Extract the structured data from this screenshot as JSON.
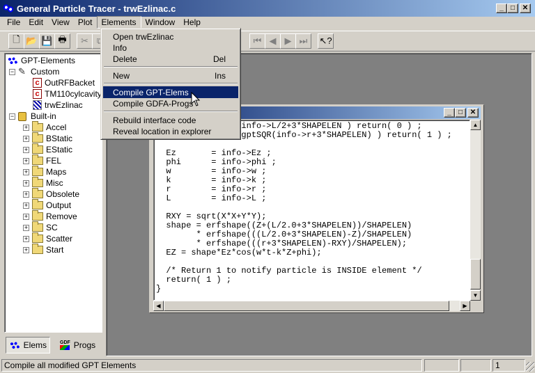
{
  "app": {
    "title": "General Particle Tracer - trwEzlinac.c"
  },
  "menubar": {
    "items": [
      "File",
      "Edit",
      "View",
      "Plot",
      "Elements",
      "Window",
      "Help"
    ]
  },
  "elements_menu": {
    "groups": [
      [
        {
          "label": "Open trwEzlinac",
          "shortcut": ""
        },
        {
          "label": "Info",
          "shortcut": ""
        },
        {
          "label": "Delete",
          "shortcut": "Del"
        }
      ],
      [
        {
          "label": "New",
          "shortcut": "Ins"
        }
      ],
      [
        {
          "label": "Compile GPT-Elems",
          "shortcut": "",
          "highlighted": true
        },
        {
          "label": "Compile GDFA-Progs",
          "shortcut": ""
        }
      ],
      [
        {
          "label": "Rebuild interface code",
          "shortcut": ""
        },
        {
          "label": "Reveal location in explorer",
          "shortcut": ""
        }
      ]
    ]
  },
  "toolbar": {
    "buttons": [
      {
        "icon": "new-file-icon",
        "glyph": "🗋",
        "enabled": true
      },
      {
        "icon": "open-folder-icon",
        "glyph": "📂",
        "enabled": true
      },
      {
        "icon": "save-icon",
        "glyph": "💾",
        "enabled": true
      },
      {
        "icon": "print-icon",
        "glyph": "🖶",
        "enabled": true
      },
      {
        "icon": "cut-icon",
        "glyph": "✂",
        "enabled": false
      },
      {
        "icon": "copy-icon",
        "glyph": "⧉",
        "enabled": false
      },
      {
        "icon": "first-icon",
        "glyph": "⏮",
        "enabled": false
      },
      {
        "icon": "previous-icon",
        "glyph": "◀",
        "enabled": false
      },
      {
        "icon": "next-icon",
        "glyph": "▶",
        "enabled": false
      },
      {
        "icon": "last-icon",
        "glyph": "⏭",
        "enabled": false
      },
      {
        "icon": "context-help-icon",
        "glyph": "↖?",
        "enabled": true
      }
    ]
  },
  "tree": {
    "root": "GPT-Elements",
    "custom": {
      "label": "Custom",
      "children": [
        {
          "label": "OutRFBacket",
          "icon": "c-source-icon"
        },
        {
          "label": "TM110cylcavity",
          "icon": "c-source-icon"
        },
        {
          "label": "trwEzlinac",
          "icon": "gpt-element-icon"
        }
      ]
    },
    "builtin": {
      "label": "Built-in",
      "children": [
        "Accel",
        "BStatic",
        "EStatic",
        "FEL",
        "Maps",
        "Misc",
        "Obsolete",
        "Output",
        "Remove",
        "SC",
        "Scatter",
        "Start"
      ]
    }
  },
  "tabs": [
    {
      "label": "Elems",
      "icon": "elements-icon",
      "active": true
    },
    {
      "label": "Progs",
      "icon": "gdf-programs-icon",
      "badge": "GDF",
      "active": false
    }
  ],
  "editor": {
    "lines": [
      "                 info->L/2+3*SHAPELEN ) return( 0 ) ;",
      "                 gptSQR(info->r+3*SHAPELEN) ) return( 1 ) ;",
      "",
      "  Ez       = info->Ez ;",
      "  phi      = info->phi ;",
      "  w        = info->w ;",
      "  k        = info->k ;",
      "  r        = info->r ;",
      "  L        = info->L ;",
      "",
      "  RXY = sqrt(X*X+Y*Y);",
      "  shape = erfshape((Z+(L/2.0+3*SHAPELEN))/SHAPELEN)",
      "        * erfshape(((L/2.0+3*SHAPELEN)-Z)/SHAPELEN)",
      "        * erfshape(((r+3*SHAPELEN)-RXY)/SHAPELEN);",
      "  EZ = shape*Ez*cos(w*t-k*Z+phi);",
      "",
      "  /* Return 1 to notify particle is INSIDE element */",
      "  return( 1 ) ;",
      "}"
    ]
  },
  "statusbar": {
    "message": "Compile all modified GPT Elements",
    "pane3": "1"
  },
  "colors": {
    "titlebar": "#0a246a",
    "highlight": "#0a246a",
    "face": "#d4d0c8",
    "mdi_background": "#808080"
  }
}
